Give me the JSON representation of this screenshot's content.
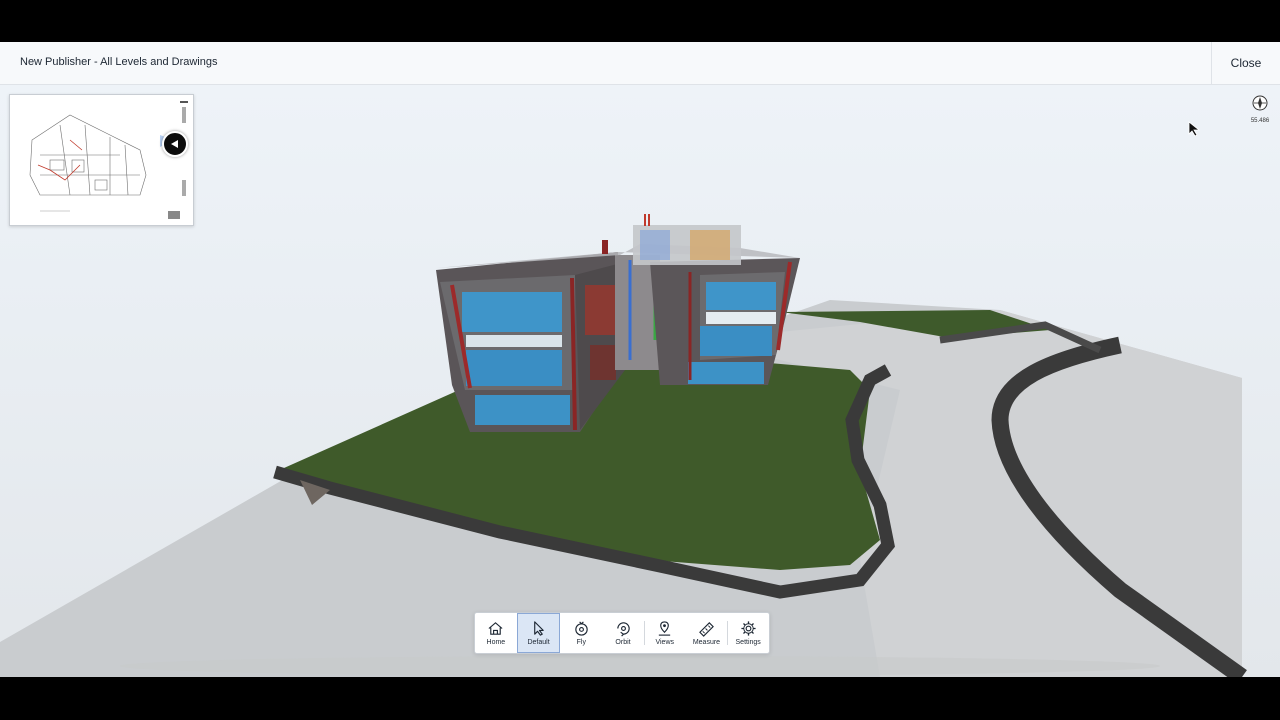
{
  "header": {
    "title": "New Publisher - All Levels and Drawings",
    "close_label": "Close"
  },
  "compass": {
    "scale_text": "55.486",
    "icon": "compass-icon"
  },
  "toolbar": {
    "tools": [
      {
        "label": "Home",
        "icon": "home-icon",
        "active": false
      },
      {
        "label": "Default",
        "icon": "pointer-icon",
        "active": true
      },
      {
        "label": "Fly",
        "icon": "fly-icon",
        "active": false
      },
      {
        "label": "Orbit",
        "icon": "orbit-icon",
        "active": false
      },
      {
        "label": "Views",
        "icon": "views-icon",
        "active": false
      },
      {
        "label": "Measure",
        "icon": "ruler-icon",
        "active": false
      },
      {
        "label": "Settings",
        "icon": "gear-icon",
        "active": false
      }
    ]
  },
  "colors": {
    "active_tool_bg": "#dbe6f5",
    "active_tool_border": "#8ba8d6",
    "grass": "#3f5a2a",
    "road": "#3a3a3a",
    "glass": "#3f95c9"
  }
}
